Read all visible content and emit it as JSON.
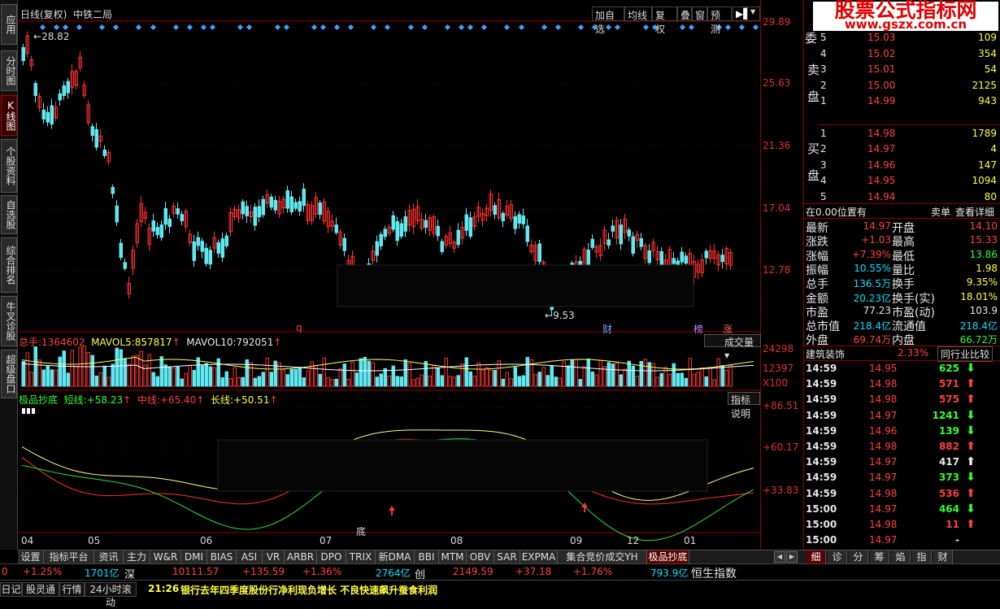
{
  "sidebar": {
    "tabs": [
      "应用",
      "分时图",
      "K线图",
      "个股资料",
      "自选股",
      "综合排名",
      "牛叉诊股",
      "超级盘口"
    ],
    "active": 2
  },
  "header": {
    "title": "日线(复权)",
    "stock": "中铁二局",
    "buttons": [
      "加自选",
      "均线",
      "复权",
      "叠",
      "窗",
      "预测"
    ]
  },
  "price_axis": [
    "29.89",
    "25.63",
    "21.36",
    "17.04",
    "12.78"
  ],
  "annot": {
    "high": "28.82",
    "low": "9.53",
    "cai": "财",
    "bang": "榜",
    "zhang": "涨",
    "q": "q",
    "di": "底"
  },
  "volume": {
    "label": "总手:",
    "total": "1364602",
    "ma5_label": "MAVOL5:",
    "ma5": "857817",
    "ma10_label": "MAVOL10:",
    "ma10": "792051",
    "select": "成交量",
    "axis": [
      "24298",
      "12397",
      "X100"
    ]
  },
  "indicator": {
    "name": "极品抄底",
    "short_label": "短线:",
    "short": "+58.23",
    "mid_label": "中线:",
    "mid": "+65.40",
    "long_label": "长线:",
    "long": "+50.51",
    "btn": "指标说明",
    "axis": [
      "+86.51",
      "+60.17",
      "+33.83"
    ]
  },
  "dates": [
    "04",
    "05",
    "06",
    "07",
    "08",
    "09",
    "12",
    "01"
  ],
  "bottom_tabs": [
    "设置",
    "指标平台",
    "资讯",
    "主力",
    "W&R",
    "DMI",
    "BIAS",
    "ASI",
    "VR",
    "ARBR",
    "DPO",
    "TRIX",
    "新DMA",
    "BBI",
    "MTM",
    "OBV",
    "SAR",
    "EXPMA",
    "集合竞价成交YH",
    "极品抄底"
  ],
  "watermark": {
    "line1": "股票公式指标网",
    "line2": "www.gszx.com.cn"
  },
  "order_book": {
    "sell_label": "卖盘",
    "buy_label": "买盘",
    "wei": "委",
    "sell": [
      [
        "5",
        "15.03",
        "109"
      ],
      [
        "4",
        "15.02",
        "354"
      ],
      [
        "3",
        "15.01",
        "54"
      ],
      [
        "2",
        "15.00",
        "2125"
      ],
      [
        "1",
        "14.99",
        "943"
      ]
    ],
    "buy": [
      [
        "1",
        "14.98",
        "1789"
      ],
      [
        "2",
        "14.97",
        "4"
      ],
      [
        "3",
        "14.96",
        "147"
      ],
      [
        "4",
        "14.95",
        "1094"
      ],
      [
        "5",
        "14.94",
        "80"
      ]
    ]
  },
  "status_row": {
    "left": "在0.00位置有",
    "right1": "卖单",
    "right2": "查看详细"
  },
  "quote": [
    [
      "最新",
      "14.97",
      "开盘",
      "14.10"
    ],
    [
      "涨跌",
      "+1.03",
      "最高",
      "15.33"
    ],
    [
      "涨幅",
      "+7.39%",
      "最低",
      "13.86"
    ],
    [
      "振幅",
      "10.55%",
      "量比",
      "1.98"
    ],
    [
      "总手",
      "136.5万",
      "换手",
      "9.35%"
    ],
    [
      "金额",
      "20.23亿",
      "换手(实)",
      "18.01%"
    ],
    [
      "市盈",
      "77.23",
      "市盈(动)",
      "103.9"
    ],
    [
      "总市值",
      "218.4亿",
      "流通值",
      "218.4亿"
    ],
    [
      "外盘",
      "69.74万",
      "内盘",
      "66.72万"
    ]
  ],
  "industry": {
    "name": "建筑装饰",
    "change": "2.33%",
    "btn": "同行业比较"
  },
  "ticks": [
    [
      "14:59",
      "14.95",
      "625",
      "d"
    ],
    [
      "14:59",
      "14.98",
      "571",
      "u"
    ],
    [
      "14:59",
      "14.98",
      "575",
      "u"
    ],
    [
      "14:59",
      "14.97",
      "1241",
      "d"
    ],
    [
      "14:59",
      "14.96",
      "139",
      "d"
    ],
    [
      "14:59",
      "14.98",
      "882",
      "u"
    ],
    [
      "14:59",
      "14.97",
      "417",
      "w"
    ],
    [
      "14:59",
      "14.97",
      "373",
      "d"
    ],
    [
      "14:59",
      "14.98",
      "536",
      "u"
    ],
    [
      "15:00",
      "14.97",
      "464",
      "d"
    ],
    [
      "15:00",
      "14.98",
      "11",
      "u"
    ],
    [
      "15:00",
      "14.97",
      "-",
      ""
    ]
  ],
  "right_tabs": [
    "细",
    "诊",
    "分",
    "筹",
    "焰",
    "指",
    "财"
  ],
  "index_bar": {
    "a": "0",
    "b": "+1.25%",
    "c": "1701亿",
    "d": "深",
    "e": "10111.57",
    "f": "+135.59",
    "g": "+1.36%",
    "h": "2764亿",
    "i": "创",
    "j": "2149.59",
    "k": "+37.18",
    "l": "+1.76%",
    "m": "793.9亿",
    "n": "恒生指数"
  },
  "news": {
    "tabs": [
      "日记",
      "股灵通",
      "行情",
      "24小时滚动"
    ],
    "time": "21:26",
    "text": "银行去年四季度股份行净利现负增长 不良快速飙升蚕食利润"
  },
  "colors": {
    "up": "#ff4040",
    "down": "#30ff30",
    "candle_down": "#60e8f0",
    "axis": "#e03030"
  }
}
